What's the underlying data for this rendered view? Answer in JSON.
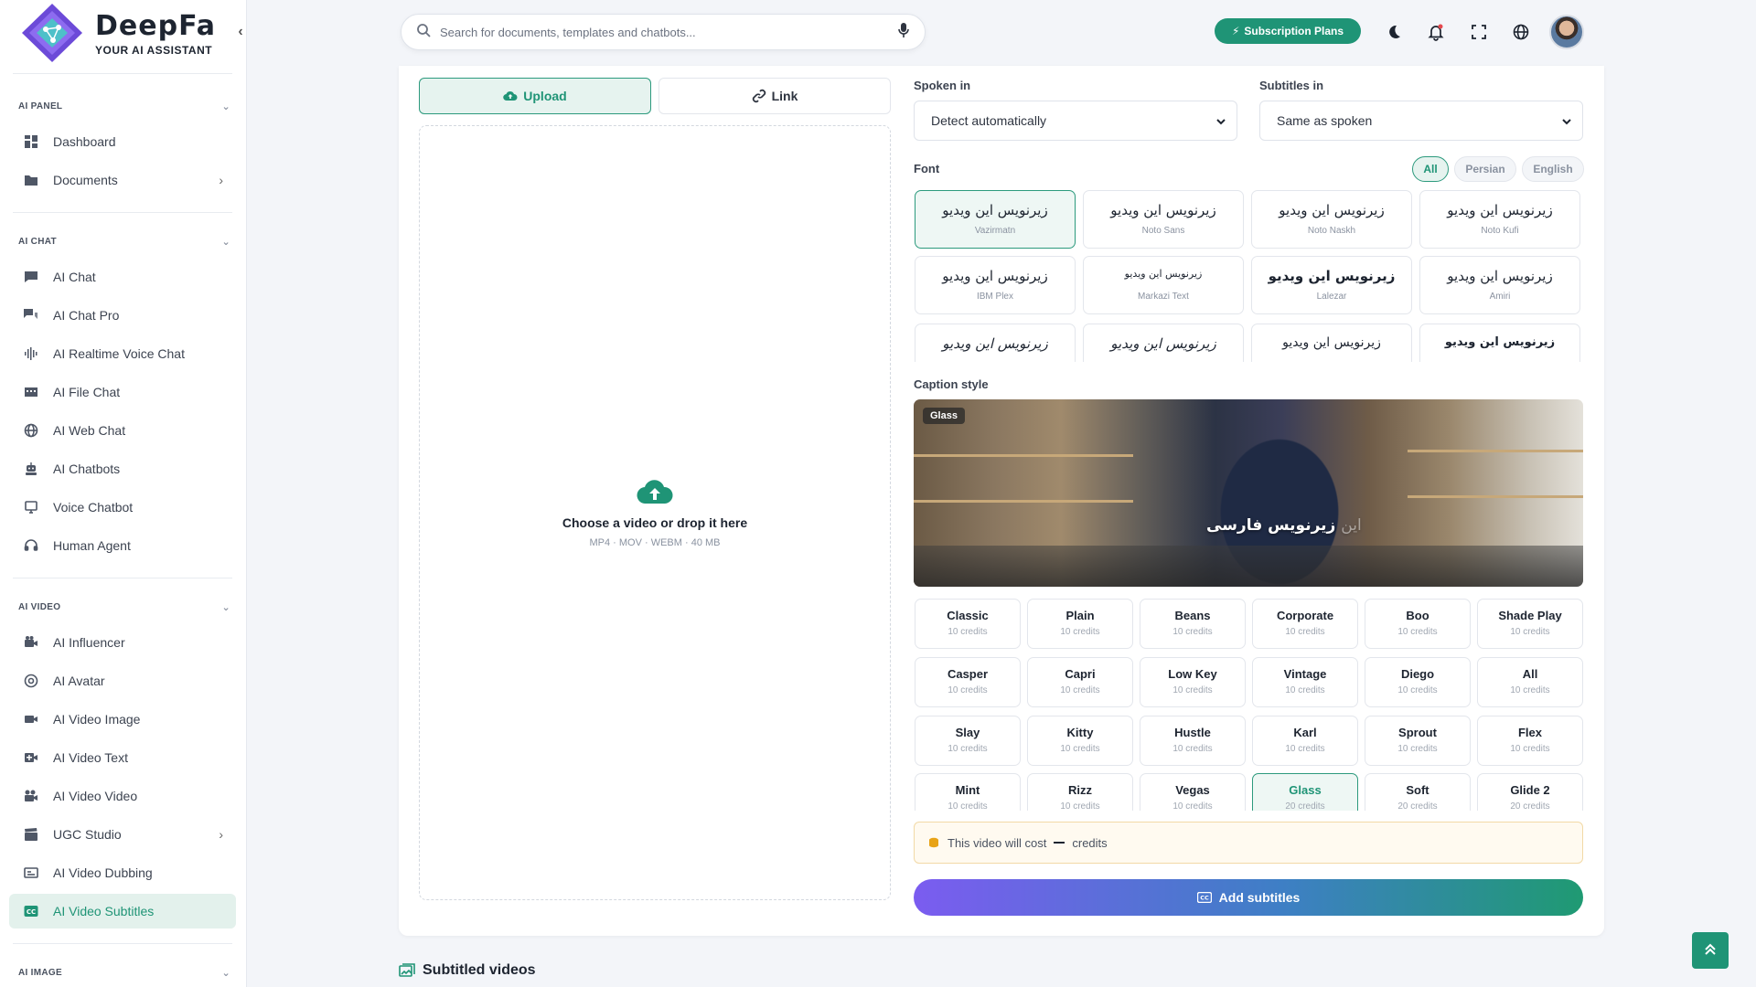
{
  "brand": {
    "name": "DeepFa",
    "tagline": "YOUR AI ASSISTANT"
  },
  "sidebar": {
    "sections": [
      {
        "label": "AI PANEL"
      },
      {
        "label": "AI CHAT"
      },
      {
        "label": "AI VIDEO"
      },
      {
        "label": "AI IMAGE"
      }
    ],
    "items": [
      {
        "label": "Dashboard",
        "icon": "dashboard-icon"
      },
      {
        "label": "Documents",
        "icon": "folder-icon"
      },
      {
        "label": "AI Chat",
        "icon": "chat-icon"
      },
      {
        "label": "AI Chat Pro",
        "icon": "chat-pro-icon"
      },
      {
        "label": "AI Realtime Voice Chat",
        "icon": "waveform-icon"
      },
      {
        "label": "AI File Chat",
        "icon": "file-chat-icon"
      },
      {
        "label": "AI Web Chat",
        "icon": "globe-icon"
      },
      {
        "label": "AI Chatbots",
        "icon": "robot-icon"
      },
      {
        "label": "Voice Chatbot",
        "icon": "voice-chatbot-icon"
      },
      {
        "label": "Human Agent",
        "icon": "headset-icon"
      },
      {
        "label": "AI Influencer",
        "icon": "camera-icon"
      },
      {
        "label": "AI Avatar",
        "icon": "avatar-icon"
      },
      {
        "label": "AI Video Image",
        "icon": "video-image-icon"
      },
      {
        "label": "AI Video Text",
        "icon": "video-text-icon"
      },
      {
        "label": "AI Video Video",
        "icon": "video-video-icon"
      },
      {
        "label": "UGC Studio",
        "icon": "clapper-icon"
      },
      {
        "label": "AI Video Dubbing",
        "icon": "dubbing-icon"
      },
      {
        "label": "AI Video Subtitles",
        "icon": "cc-icon"
      }
    ]
  },
  "header": {
    "search_placeholder": "Search for documents, templates and chatbots...",
    "subscription_label": "Subscription Plans"
  },
  "upload": {
    "tab_upload": "Upload",
    "tab_link": "Link",
    "drop_title": "Choose a video or drop it here",
    "drop_hint": "MP4 · MOV · WEBM · 40 MB"
  },
  "settings": {
    "spoken_label": "Spoken in",
    "spoken_value": "Detect automatically",
    "subtitles_label": "Subtitles in",
    "subtitles_value": "Same as spoken",
    "font_label": "Font",
    "filters": [
      "All",
      "Persian",
      "English"
    ],
    "fonts": [
      {
        "sample": "زیرنویس این ویدیو",
        "name": "Vazirmatn"
      },
      {
        "sample": "زیرنویس این ویدیو",
        "name": "Noto Sans"
      },
      {
        "sample": "زیرنویس این ویدیو",
        "name": "Noto Naskh"
      },
      {
        "sample": "زیرنویس این ویدیو",
        "name": "Noto Kufi"
      },
      {
        "sample": "زیرنویس این ویدیو",
        "name": "IBM Plex"
      },
      {
        "sample": "زیرنویس این ویدیو",
        "name": "Markazi Text"
      },
      {
        "sample": "زیرنویس این ویدیو",
        "name": "Lalezar"
      },
      {
        "sample": "زیرنویس این ویدیو",
        "name": "Amiri"
      },
      {
        "sample": "زیرنویس این ویدیو",
        "name": ""
      },
      {
        "sample": "زیرنویس این ویدیو",
        "name": ""
      },
      {
        "sample": "زیرنویس این ویدیو",
        "name": ""
      },
      {
        "sample": "زیرنویس این ویدیو",
        "name": ""
      }
    ],
    "caption_label": "Caption style",
    "preview_badge": "Glass",
    "preview_caption": "زیرنویس فارسی",
    "preview_caption_dim": "این",
    "styles": [
      {
        "name": "Classic",
        "credits": "10 credits"
      },
      {
        "name": "Plain",
        "credits": "10 credits"
      },
      {
        "name": "Beans",
        "credits": "10 credits"
      },
      {
        "name": "Corporate",
        "credits": "10 credits"
      },
      {
        "name": "Boo",
        "credits": "10 credits"
      },
      {
        "name": "Shade Play",
        "credits": "10 credits"
      },
      {
        "name": "Casper",
        "credits": "10 credits"
      },
      {
        "name": "Capri",
        "credits": "10 credits"
      },
      {
        "name": "Low Key",
        "credits": "10 credits"
      },
      {
        "name": "Vintage",
        "credits": "10 credits"
      },
      {
        "name": "Diego",
        "credits": "10 credits"
      },
      {
        "name": "All",
        "credits": "10 credits"
      },
      {
        "name": "Slay",
        "credits": "10 credits"
      },
      {
        "name": "Kitty",
        "credits": "10 credits"
      },
      {
        "name": "Hustle",
        "credits": "10 credits"
      },
      {
        "name": "Karl",
        "credits": "10 credits"
      },
      {
        "name": "Sprout",
        "credits": "10 credits"
      },
      {
        "name": "Flex",
        "credits": "10 credits"
      },
      {
        "name": "Mint",
        "credits": "10 credits"
      },
      {
        "name": "Rizz",
        "credits": "10 credits"
      },
      {
        "name": "Vegas",
        "credits": "10 credits"
      },
      {
        "name": "Glass",
        "credits": "20 credits"
      },
      {
        "name": "Soft",
        "credits": "20 credits"
      },
      {
        "name": "Glide 2",
        "credits": "20 credits"
      }
    ],
    "cost_prefix": "This video will cost",
    "cost_suffix": "credits",
    "add_button": "Add subtitles"
  },
  "subtitled_videos_title": "Subtitled videos",
  "colors": {
    "accent": "#1f9476",
    "accent_light": "#e6f3ef",
    "warning_bg": "#fffaf0"
  }
}
